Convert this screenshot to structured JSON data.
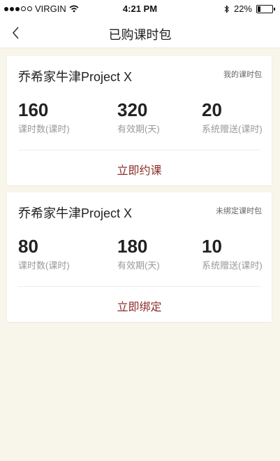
{
  "status_bar": {
    "carrier": "VIRGIN",
    "time": "4:21 PM",
    "battery_percent": "22%",
    "battery_level": 0.22,
    "signal_bars_filled": 3,
    "signal_bars_total": 5,
    "icons": [
      "signal-icon",
      "wifi-icon",
      "bluetooth-icon",
      "battery-icon"
    ]
  },
  "nav": {
    "title": "已购课时包",
    "back_icon": "chevron-left-icon"
  },
  "cards": [
    {
      "title": "乔希家牛津Project X",
      "tag": "我的课时包",
      "stats": [
        {
          "value": "160",
          "label": "课时数(课时)"
        },
        {
          "value": "320",
          "label": "有效期(天)"
        },
        {
          "value": "20",
          "label": "系统赠送(课时)"
        }
      ],
      "action": "立即约课"
    },
    {
      "title": "乔希家牛津Project X",
      "tag": "未绑定课时包",
      "stats": [
        {
          "value": "80",
          "label": "课时数(课时)"
        },
        {
          "value": "180",
          "label": "有效期(天)"
        },
        {
          "value": "10",
          "label": "系统赠送(课时)"
        }
      ],
      "action": "立即绑定"
    }
  ],
  "colors": {
    "page_background": "#f8f5ea",
    "card_background": "#ffffff",
    "action_text": "#8b2e2a",
    "label_text": "#9a9a9a"
  }
}
